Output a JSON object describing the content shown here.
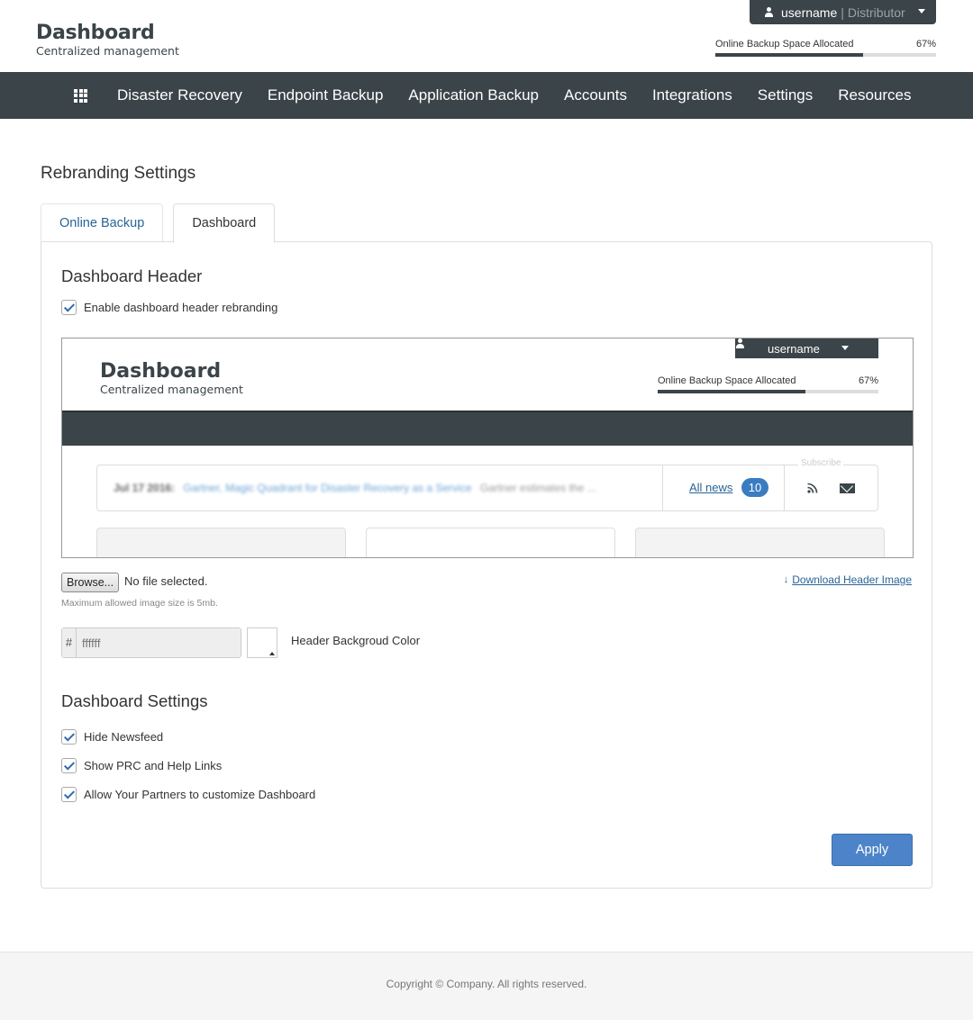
{
  "header": {
    "brand_title": "Dashboard",
    "brand_subtitle": "Centralized management",
    "username": "username",
    "role_separator": "|",
    "role": "Distributor",
    "space_label": "Online Backup Space Allocated",
    "space_percent_text": "67%",
    "space_percent": 67
  },
  "nav": {
    "items": [
      {
        "label": "Disaster Recovery"
      },
      {
        "label": "Endpoint Backup"
      },
      {
        "label": "Application Backup"
      },
      {
        "label": "Accounts"
      },
      {
        "label": "Integrations"
      },
      {
        "label": "Settings"
      },
      {
        "label": "Resources"
      }
    ]
  },
  "page": {
    "title": "Rebranding Settings",
    "tabs": [
      {
        "label": "Online Backup",
        "active": false
      },
      {
        "label": "Dashboard",
        "active": true
      }
    ]
  },
  "dashboard_header": {
    "title": "Dashboard Header",
    "enable_label": "Enable dashboard header rebranding",
    "enabled": true,
    "preview": {
      "brand_title": "Dashboard",
      "brand_subtitle": "Centralized management",
      "username": "username",
      "space_label": "Online Backup Space Allocated",
      "space_percent_text": "67%",
      "news_date": "Jul 17 2016:",
      "news_headline": "Gartner, Magic Quadrant for Disaster Recovery as a Service",
      "news_snippet": "Gartner estimates the ...",
      "all_news": "All news",
      "news_count": "10",
      "subscribe": "Subscribe"
    },
    "browse_label": "Browse...",
    "file_status": "No file selected.",
    "download_label": "Download Header Image",
    "size_hint": "Maximum allowed image size is 5mb.",
    "color_hash": "#",
    "color_placeholder": "ffffff",
    "color_label": "Header Backgroud Color",
    "color_value": "#ffffff"
  },
  "dashboard_settings": {
    "title": "Dashboard Settings",
    "options": [
      {
        "label": "Hide Newsfeed",
        "checked": true
      },
      {
        "label": "Show PRC and Help Links",
        "checked": true
      },
      {
        "label": "Allow Your Partners to customize Dashboard",
        "checked": true
      }
    ],
    "apply_label": "Apply"
  },
  "footer": {
    "text": "Copyright ©  Company.  All rights reserved."
  },
  "colors": {
    "header_dark": "#3a4449",
    "link": "#2a6496",
    "primary_button": "#4d84c9",
    "badge": "#3a7cc2"
  }
}
